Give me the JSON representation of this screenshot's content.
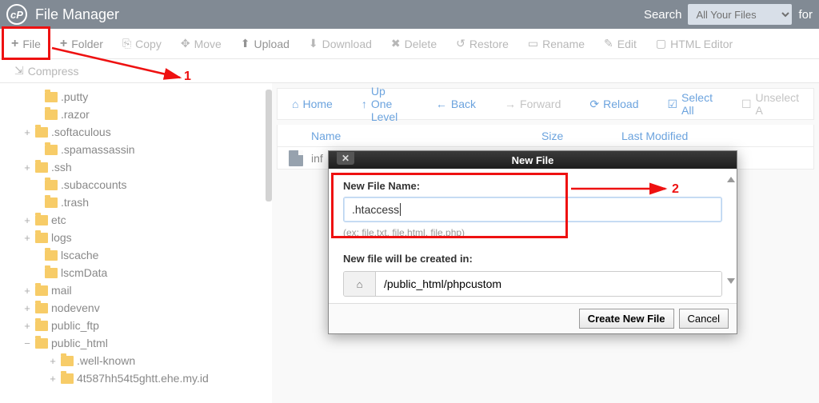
{
  "header": {
    "title": "File Manager",
    "search_label": "Search",
    "search_select": "All Your Files",
    "for_label": "for"
  },
  "toolbar": {
    "file": "File",
    "folder": "Folder",
    "copy": "Copy",
    "move": "Move",
    "upload": "Upload",
    "download": "Download",
    "delete": "Delete",
    "restore": "Restore",
    "rename": "Rename",
    "edit": "Edit",
    "html_editor": "HTML Editor",
    "compress": "Compress"
  },
  "sidebar": {
    "items": [
      {
        "exp": "",
        "ind": 1,
        "name": ".putty"
      },
      {
        "exp": "",
        "ind": 1,
        "name": ".razor"
      },
      {
        "exp": "+",
        "ind": 0,
        "name": ".softaculous"
      },
      {
        "exp": "",
        "ind": 1,
        "name": ".spamassassin"
      },
      {
        "exp": "+",
        "ind": 0,
        "name": ".ssh"
      },
      {
        "exp": "",
        "ind": 1,
        "name": ".subaccounts"
      },
      {
        "exp": "",
        "ind": 1,
        "name": ".trash"
      },
      {
        "exp": "+",
        "ind": 0,
        "name": "etc"
      },
      {
        "exp": "+",
        "ind": 0,
        "name": "logs"
      },
      {
        "exp": "",
        "ind": 1,
        "name": "lscache"
      },
      {
        "exp": "",
        "ind": 1,
        "name": "lscmData"
      },
      {
        "exp": "+",
        "ind": 0,
        "name": "mail"
      },
      {
        "exp": "+",
        "ind": 0,
        "name": "nodevenv"
      },
      {
        "exp": "+",
        "ind": 0,
        "name": "public_ftp"
      },
      {
        "exp": "−",
        "ind": 0,
        "name": "public_html"
      },
      {
        "exp": "+",
        "ind": 2,
        "name": ".well-known"
      },
      {
        "exp": "+",
        "ind": 2,
        "name": "4t587hh54t5ghtt.ehe.my.id"
      }
    ]
  },
  "content_toolbar": {
    "home": "Home",
    "up": "Up One Level",
    "back": "Back",
    "forward": "Forward",
    "reload": "Reload",
    "select_all": "Select All",
    "unselect": "Unselect A"
  },
  "table": {
    "headers": {
      "name": "Name",
      "size": "Size",
      "modified": "Last Modified"
    },
    "rows": [
      {
        "name": "inf"
      }
    ]
  },
  "modal": {
    "title": "New File",
    "name_label": "New File Name:",
    "name_value": ".htaccess",
    "hint": "(ex: file.txt, file.html, file.php)",
    "path_label": "New file will be created in:",
    "path_value": "/public_html/phpcustom",
    "create_btn": "Create New File",
    "cancel_btn": "Cancel"
  },
  "annotations": {
    "one": "1",
    "two": "2"
  }
}
